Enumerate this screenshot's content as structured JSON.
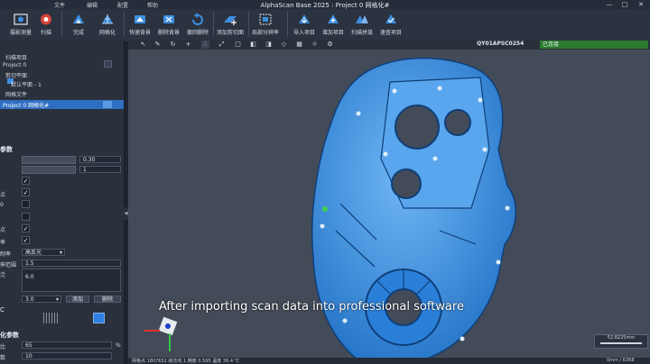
{
  "titlebar": {
    "menus": [
      "文件",
      "编辑",
      "配置",
      "帮助"
    ],
    "title": "AlphaScan Base 2025 : Project 0 网格化#",
    "controls": [
      "—",
      "□",
      "✕"
    ]
  },
  "toolbar": {
    "buttons": [
      {
        "label": "摄影测量",
        "icon": "photogrammetry-icon"
      },
      {
        "label": "扫描",
        "icon": "scan-icon"
      },
      {
        "label": "完成",
        "icon": "finish-icon"
      },
      {
        "label": "网格化",
        "icon": "mesh-icon"
      },
      {
        "label": "快速背景",
        "icon": "quick-background-icon"
      },
      {
        "label": "删除背景",
        "icon": "delete-background-icon"
      },
      {
        "label": "撤回删除",
        "icon": "undo-delete-icon"
      },
      {
        "label": "添加剪切面",
        "icon": "add-clip-plane-icon"
      },
      {
        "label": "局部分辨率",
        "icon": "local-resolution-icon"
      },
      {
        "label": "导入项目",
        "icon": "import-project-icon"
      },
      {
        "label": "增加项目",
        "icon": "add-project-icon"
      },
      {
        "label": "扫描拼接",
        "icon": "scan-stitch-icon"
      },
      {
        "label": "速查项目",
        "icon": "quick-check-project-icon"
      }
    ],
    "colors": {
      "icon_blue": "#3d8fe0",
      "icon_red": "#d8443b"
    }
  },
  "left_panel": {
    "tree": {
      "scan_items": "扫描项目",
      "project": "Project 0",
      "clip_planes": "剪切平面",
      "default_plane": "默认平面 - 1",
      "mesh_files": "网格文件",
      "selected": "Project 0 网格化#"
    },
    "params_header": "参数",
    "param_value_1": "0.30",
    "param_value_2": "1",
    "row_labels": [
      "点",
      "0",
      "点",
      "率",
      "制率",
      "伸范围",
      "泛"
    ],
    "dropdown_value": "高反光",
    "range_value": "1.5",
    "text_value": "6.0",
    "spin_value": "3.0",
    "add_button": "添加",
    "delete_button": "删除",
    "section_c": "C",
    "opt_header": "化参数",
    "ratio_label": "比",
    "ratio_value": "65",
    "ratio_unit": "%",
    "count_label": "数",
    "count_value": "10"
  },
  "viewport": {
    "device_id": "QY01APSC0254",
    "status": "已连接",
    "subtitle": "After importing scan data into professional software",
    "scale_value": "52.8225mm",
    "statusbar": "网格点  1807652      剔法线  1      精度  0.595      温度  36.4 ℃",
    "statusbar_right": "0mm / 6368",
    "colors": {
      "part_blue": "#2f8fe8",
      "background": "#434b58",
      "status_green": "#2a7a2e"
    }
  }
}
